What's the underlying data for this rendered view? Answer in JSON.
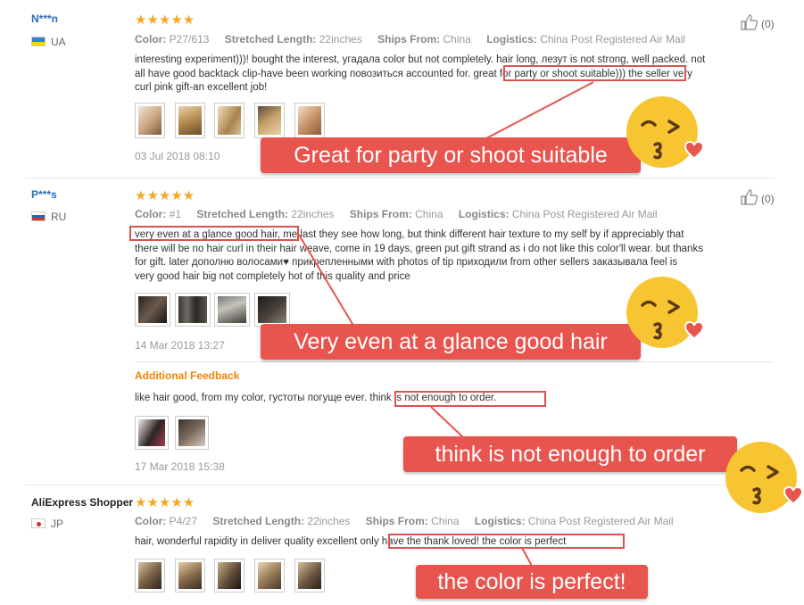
{
  "reviews": [
    {
      "user": "N***n",
      "country": "UA",
      "stars": "★★★★★",
      "likes": "(0)",
      "color_label": "Color:",
      "color": "P27/613",
      "length_label": "Stretched Length:",
      "length": "22inches",
      "ships_label": "Ships From:",
      "ships": "China",
      "logistics_label": "Logistics:",
      "logistics": "China Post Registered Air Mail",
      "text_lines": [
        "interesting experiment)))! bought the interest, угадала color but not completely. hair long, лезут is not strong, well packed. not",
        "all have good backtack clip-have been working повозиться accounted for. great for party or shoot suitable))) the seller very",
        "curl pink gift-an excellent job!"
      ],
      "date": "03 Jul 2018 08:10",
      "callout": "Great for party or shoot suitable"
    },
    {
      "user": "P***s",
      "country": "RU",
      "stars": "★★★★★",
      "likes": "(0)",
      "color_label": "Color:",
      "color": "#1",
      "length_label": "Stretched Length:",
      "length": "22inches",
      "ships_label": "Ships From:",
      "ships": "China",
      "logistics_label": "Logistics:",
      "logistics": "China Post Registered Air Mail",
      "text_lines": [
        "very even at a glance good hair, me last they see how long, but think different hair texture to my self by if appreciably that",
        "there will be no hair curl in their hair weave, come in 19 days, green put gift strand as i do not like this color'll wear. but thanks",
        "for gift. later дополню волосами♥ прикрепленными with photos of tip приходили from other sellers заказывала feel is",
        "very good hair big not completely hot of this quality and price"
      ],
      "date": "14 Mar 2018 13:27",
      "callout": "Very even at a glance good hair",
      "additional_label": "Additional Feedback",
      "additional_text": "like hair good, from my color, густоты погуще ever. think is not enough to order.",
      "additional_date": "17 Mar 2018 15:38",
      "additional_callout": "think is not enough to order"
    },
    {
      "user": "AliExpress Shopper",
      "country": "JP",
      "stars": "★★★★★",
      "color_label": "Color:",
      "color": "P4/27",
      "length_label": "Stretched Length:",
      "length": "22inches",
      "ships_label": "Ships From:",
      "ships": "China",
      "logistics_label": "Logistics:",
      "logistics": "China Post Registered Air Mail",
      "text_lines": [
        "hair, wonderful rapidity in deliver quality excellent only have the thank loved! the color is perfect"
      ],
      "callout": "the color is perfect!"
    }
  ],
  "icons": {
    "like": "thumbs-up-icon",
    "emoji": "kissing-wink-heart-emoji"
  },
  "colors": {
    "accent_red": "#e8544e",
    "star": "#f5a623",
    "username": "#2a6ebb",
    "additional": "#f08300"
  }
}
